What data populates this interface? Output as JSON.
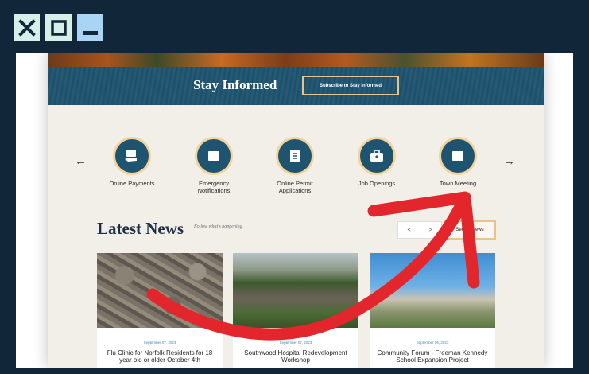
{
  "window": {
    "controls": [
      {
        "name": "close",
        "icon": "close-x-icon"
      },
      {
        "name": "maximize",
        "icon": "maximize-square-icon"
      },
      {
        "name": "minimize",
        "icon": "minimize-bar-icon"
      }
    ]
  },
  "colors": {
    "frame": "#12263a",
    "band": "#1f5470",
    "accent_gold": "#e9c48a",
    "annotation_arrow": "#e3262b"
  },
  "stay_informed": {
    "title": "Stay Informed",
    "button_label": "Subscribe to Stay Informed"
  },
  "quick_links": {
    "prev_icon": "←",
    "next_icon": "→",
    "items": [
      {
        "label": "Online Payments",
        "icon": "payment-hand-icon"
      },
      {
        "label": "Emergency\nNotifications",
        "icon": "megaphone-icon"
      },
      {
        "label": "Online Permit\nApplications",
        "icon": "document-icon"
      },
      {
        "label": "Job Openings",
        "icon": "briefcase-icon"
      },
      {
        "label": "Town Meeting",
        "icon": "megaphone-icon"
      }
    ]
  },
  "news": {
    "title": "Latest News",
    "tagline": "Follow what's happening",
    "pager_prev": "<",
    "pager_next": ">",
    "see_all": "See All News",
    "cards": [
      {
        "date": "September 07, 2023",
        "headline": "Flu Clinic for Norfolk Residents for 18 year old or older October 4th"
      },
      {
        "date": "September 07, 2023",
        "headline": "Southwood Hospital Redevelopment Workshop"
      },
      {
        "date": "September 06, 2023",
        "headline": "Community Forum - Freeman Kennedy School Expansion Project"
      }
    ]
  }
}
